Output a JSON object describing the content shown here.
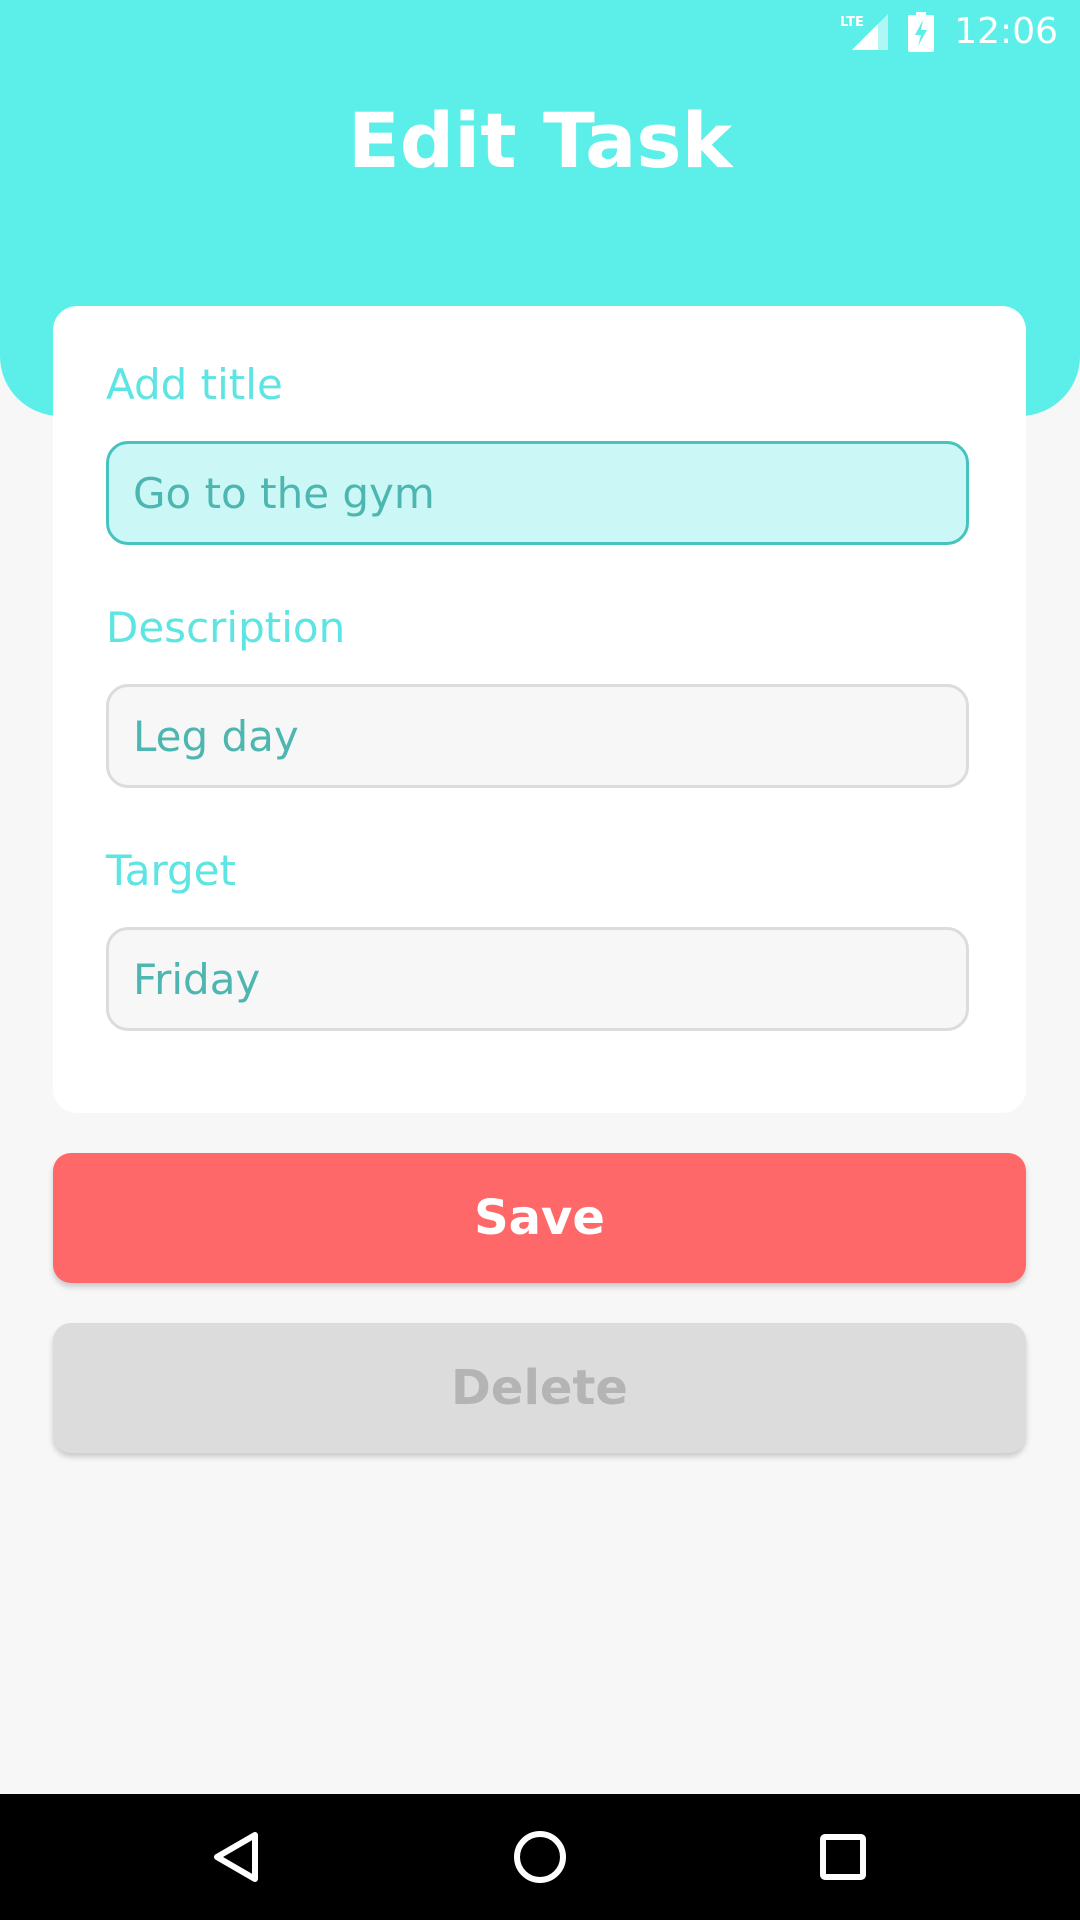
{
  "status_bar": {
    "network": "LTE",
    "time": "12:06"
  },
  "header": {
    "title": "Edit Task",
    "color": "#5ceee9"
  },
  "form": {
    "title_field": {
      "label": "Add title",
      "value": "Go to the gym"
    },
    "description_field": {
      "label": "Description",
      "value": "Leg day"
    },
    "target_field": {
      "label": "Target",
      "value": "Friday"
    }
  },
  "actions": {
    "save_label": "Save",
    "delete_label": "Delete",
    "save_color": "#ff6868",
    "delete_color": "#dcdcdc"
  },
  "nav_bar": {
    "back_icon": "back-triangle-icon",
    "home_icon": "home-circle-icon",
    "recents_icon": "recents-square-icon"
  }
}
